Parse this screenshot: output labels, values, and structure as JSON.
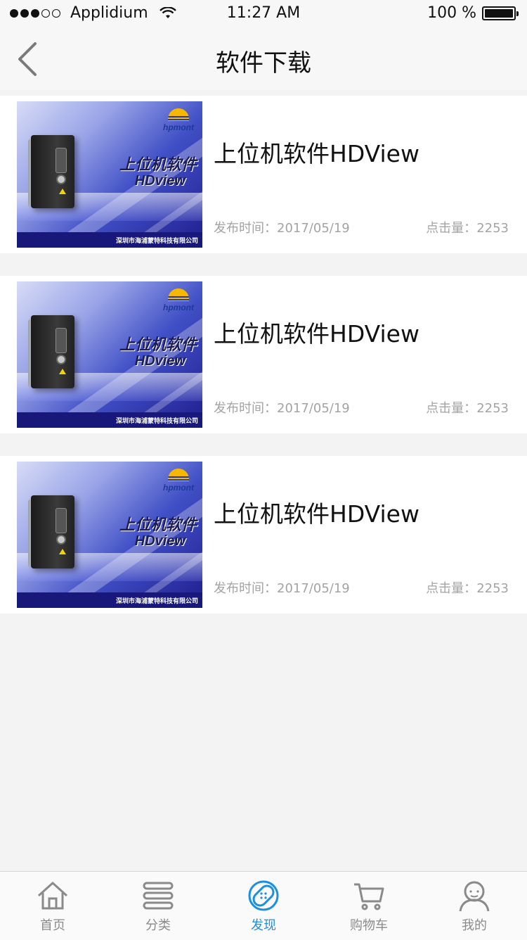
{
  "status_bar": {
    "carrier": "Applidium",
    "time": "11:27 AM",
    "battery": "100 %"
  },
  "nav": {
    "title": "软件下载"
  },
  "items": [
    {
      "title": "上位机软件HDView",
      "date_label": "发布时间：",
      "date": "2017/05/19",
      "clicks_label": "点击量：",
      "clicks": "2253",
      "thumb": {
        "brand": "hpmont",
        "title": "上位机软件",
        "subtitle": "HDview",
        "footer": "深圳市海浦蒙特科技有限公司"
      }
    },
    {
      "title": "上位机软件HDView",
      "date_label": "发布时间：",
      "date": "2017/05/19",
      "clicks_label": "点击量：",
      "clicks": "2253",
      "thumb": {
        "brand": "hpmont",
        "title": "上位机软件",
        "subtitle": "HDview",
        "footer": "深圳市海浦蒙特科技有限公司"
      }
    },
    {
      "title": "上位机软件HDView",
      "date_label": "发布时间：",
      "date": "2017/05/19",
      "clicks_label": "点击量：",
      "clicks": "2253",
      "thumb": {
        "brand": "hpmont",
        "title": "上位机软件",
        "subtitle": "HDview",
        "footer": "深圳市海浦蒙特科技有限公司"
      }
    }
  ],
  "tab_bar": {
    "tabs": [
      {
        "label": "首页",
        "icon": "home-icon"
      },
      {
        "label": "分类",
        "icon": "category-icon"
      },
      {
        "label": "发现",
        "icon": "discover-icon",
        "active": true
      },
      {
        "label": "购物车",
        "icon": "cart-icon"
      },
      {
        "label": "我的",
        "icon": "profile-icon"
      }
    ]
  },
  "colors": {
    "accent": "#1d8fe1",
    "inactive": "#8a8a8a",
    "meta_text": "#a3a3a3",
    "background": "#f3f3f3"
  }
}
